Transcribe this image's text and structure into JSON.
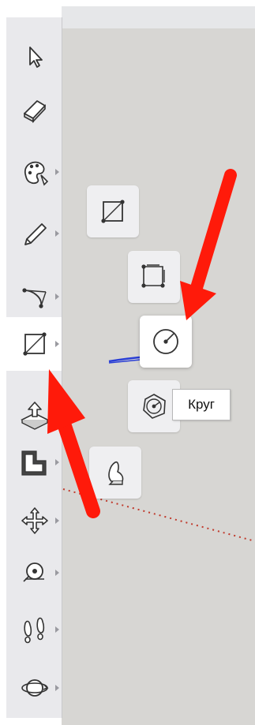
{
  "tooltip": {
    "text": "Круг"
  },
  "toolbar": {
    "items": [
      {
        "name": "select-tool",
        "icon": "arrow-cursor-icon"
      },
      {
        "name": "eraser-tool",
        "icon": "eraser-icon"
      },
      {
        "name": "paint-bucket-tool",
        "icon": "paint-palette-icon"
      },
      {
        "name": "line-tool",
        "icon": "pencil-icon"
      },
      {
        "name": "arc-tool",
        "icon": "arc-icon"
      },
      {
        "name": "shapes-tool",
        "icon": "rectangle-icon",
        "active": true
      },
      {
        "name": "push-pull-tool",
        "icon": "push-pull-icon"
      },
      {
        "name": "offset-tool",
        "icon": "offset-icon"
      },
      {
        "name": "move-tool",
        "icon": "move-arrows-icon"
      },
      {
        "name": "tape-measure-tool",
        "icon": "tape-measure-icon"
      },
      {
        "name": "walk-tool",
        "icon": "footprints-icon"
      },
      {
        "name": "orbit-tool",
        "icon": "orbit-icon"
      }
    ]
  },
  "flyout": {
    "items": [
      {
        "name": "rectangle-option",
        "icon": "rectangle-icon"
      },
      {
        "name": "rotated-rectangle-option",
        "icon": "rotated-rectangle-icon"
      },
      {
        "name": "circle-option",
        "icon": "circle-icon",
        "hovered": true
      },
      {
        "name": "polygon-option",
        "icon": "polygon-icon"
      },
      {
        "name": "freehand-option",
        "icon": "freehand-icon"
      }
    ]
  },
  "colors": {
    "arrow": "#ff1a0a",
    "axis": "#c0392b",
    "blue_axis": "#2a3fd6"
  }
}
